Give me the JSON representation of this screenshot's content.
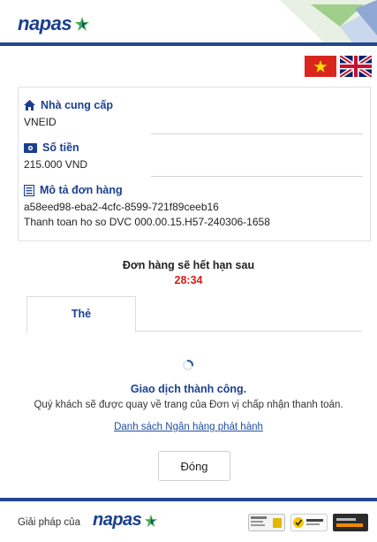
{
  "header": {
    "logo_text": "napas"
  },
  "languages": [
    {
      "code": "vi",
      "icon": "vietnam-flag-icon"
    },
    {
      "code": "en",
      "icon": "uk-flag-icon"
    }
  ],
  "order": {
    "provider_label": "Nhà cung cấp",
    "provider_value": "VNEID",
    "amount_label": "Số tiền",
    "amount_value": "215.000 VND",
    "description_label": "Mô tả đơn hàng",
    "description_line1": "a58eed98-eba2-4cfc-8599-721f89ceeb16",
    "description_line2": "Thanh toan ho so DVC 000.00.15.H57-240306-1658"
  },
  "expiry": {
    "label": "Đơn hàng sẽ hết hạn sau",
    "countdown": "28:34"
  },
  "tabs": [
    {
      "label": "Thẻ",
      "active": true
    }
  ],
  "status": {
    "title": "Giao dịch thành công.",
    "message": "Quý khách sẽ được quay về trang của Đơn vị chấp nhận thanh toán.",
    "bank_list_link": "Danh sách Ngân hàng phát hành"
  },
  "actions": {
    "close_label": "Đóng"
  },
  "footer": {
    "solution_text": "Giải pháp của",
    "logo_text": "napas"
  },
  "colors": {
    "brand_blue": "#1b3f8f",
    "countdown_red": "#d31c1c",
    "accent_green": "#3fae49"
  }
}
